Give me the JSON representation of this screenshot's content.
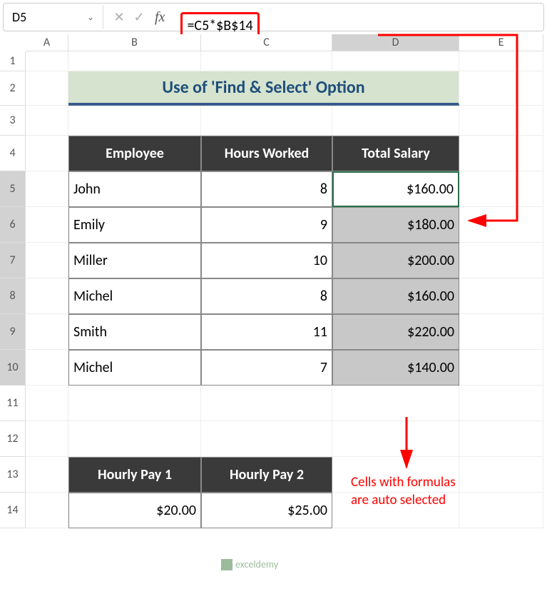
{
  "namebox": "D5",
  "formula": "=C5*$B$14",
  "columns": [
    "A",
    "B",
    "C",
    "D",
    "E"
  ],
  "active_col": "D",
  "rows": [
    "1",
    "2",
    "3",
    "4",
    "5",
    "6",
    "7",
    "8",
    "9",
    "10",
    "11",
    "12",
    "13",
    "14"
  ],
  "active_rows": [
    "5",
    "6",
    "7",
    "8",
    "9",
    "10"
  ],
  "title": "Use of 'Find & Select' Option",
  "headers": {
    "employee": "Employee",
    "hours": "Hours Worked",
    "salary": "Total Salary"
  },
  "data": [
    {
      "name": "John",
      "hours": "8",
      "salary": "$160.00"
    },
    {
      "name": "Emily",
      "hours": "9",
      "salary": "$180.00"
    },
    {
      "name": "Miller",
      "hours": "10",
      "salary": "$200.00"
    },
    {
      "name": "Michel",
      "hours": "8",
      "salary": "$160.00"
    },
    {
      "name": "Smith",
      "hours": "11",
      "salary": "$220.00"
    },
    {
      "name": "Michel",
      "hours": "7",
      "salary": "$140.00"
    }
  ],
  "pay_headers": {
    "p1": "Hourly Pay 1",
    "p2": "Hourly Pay 2"
  },
  "pay_values": {
    "p1": "$20.00",
    "p2": "$25.00"
  },
  "annotation": "Cells with formulas\nare auto selected",
  "watermark": "exceldemy",
  "icons": {
    "cancel": "✕",
    "enter": "✓",
    "fx": "fx",
    "dropdown": "⌄"
  }
}
